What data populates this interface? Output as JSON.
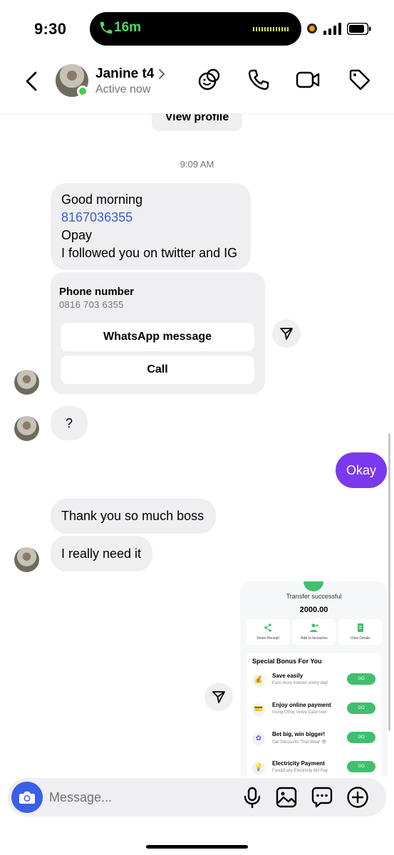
{
  "status_bar": {
    "time": "9:30",
    "call_timer": "16m"
  },
  "header": {
    "contact_name": "Janine t4",
    "active_status": "Active now",
    "icons": [
      "back-icon",
      "effects-icon",
      "phone-icon",
      "video-icon",
      "tag-icon"
    ]
  },
  "chat": {
    "view_profile_label": "View profile",
    "timestamp": "9:09 AM",
    "message_1": {
      "line_1": "Good morning",
      "phone": "8167036355",
      "line_3": "Opay",
      "line_4": "I followed you on twitter and IG"
    },
    "contact_card": {
      "title": "Phone number",
      "number": "0816 703 6355",
      "whatsapp_label": "WhatsApp message",
      "call_label": "Call"
    },
    "message_2": "?",
    "outgoing_1": "Okay",
    "message_3": "Thank you so much boss",
    "message_4": "I really need it"
  },
  "opay_screenshot": {
    "status": "Transfer successful",
    "amount": "2000.00",
    "actions": [
      "Share Receipt",
      "Add to favourites",
      "View Details"
    ],
    "panel_title": "Special Bonus For You",
    "rows": [
      {
        "title": "Save easily",
        "subtitle": "Earn more interest every day!",
        "go": "GO",
        "icon": "💰"
      },
      {
        "title": "Enjoy online payment",
        "subtitle": "Using OPay Verve Card now",
        "go": "GO",
        "icon": "💳"
      },
      {
        "title": "Bet big, win bigger!",
        "subtitle": "Get Discounts That Wow! 😎",
        "go": "GO",
        "icon": "✿"
      },
      {
        "title": "Electricity Payment",
        "subtitle": "Fast&Easy Electricity Bill Pay",
        "go": "GO",
        "icon": "💡"
      }
    ]
  },
  "composer": {
    "placeholder": "Message..."
  },
  "colors": {
    "accent_purple": "#7b39ed",
    "camera_blue": "#3a60e8",
    "online_green": "#3ecf4d",
    "link_blue": "#3a5cd6",
    "bubble_gray": "#efeff1"
  }
}
